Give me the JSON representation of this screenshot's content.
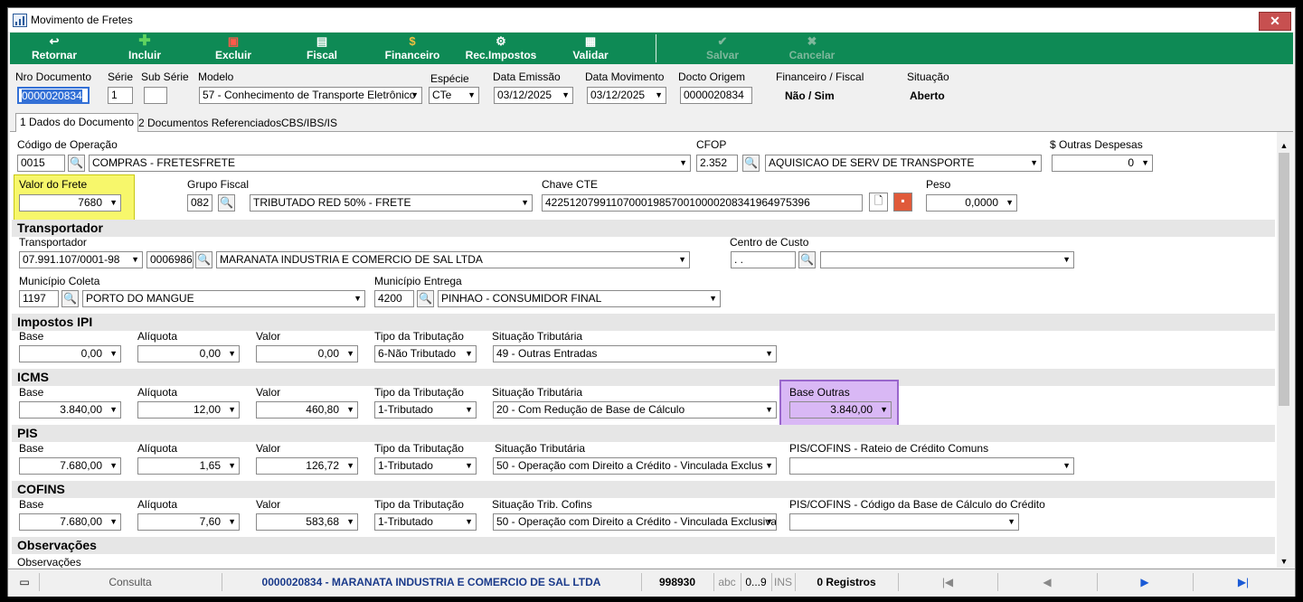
{
  "window": {
    "title": "Movimento de Fretes",
    "close_symbol": "✕"
  },
  "toolbar": {
    "retornar": "Retornar",
    "incluir": "Incluir",
    "excluir": "Excluir",
    "fiscal": "Fiscal",
    "financeiro": "Financeiro",
    "rec_impostos": "Rec.Impostos",
    "validar": "Validar",
    "salvar": "Salvar",
    "cancelar": "Cancelar"
  },
  "header": {
    "nro_documento_label": "Nro Documento",
    "nro_documento": "0000020834",
    "serie_label": "Série",
    "serie": "1",
    "sub_serie_label": "Sub Série",
    "sub_serie": "",
    "modelo_label": "Modelo",
    "modelo": "57 - Conhecimento de Transporte Eletrônico",
    "especie_label": "Espécie",
    "especie": "CTe",
    "data_emissao_label": "Data Emissão",
    "data_emissao": "03/12/2025",
    "data_movimento_label": "Data Movimento",
    "data_movimento": "03/12/2025",
    "docto_origem_label": "Docto Origem",
    "docto_origem": "0000020834",
    "financeiro_fiscal_label": "Financeiro / Fiscal",
    "financeiro_fiscal": "Não / Sim",
    "situacao_label": "Situação",
    "situacao": "Aberto"
  },
  "tabs": [
    "1 Dados do Documento",
    "2 Documentos Referenciados",
    "CBS/IBS/IS"
  ],
  "dados": {
    "codigo_operacao_label": "Código de Operação",
    "codigo_operacao": "0015",
    "operacao_desc": "COMPRAS - FRETESFRETE",
    "cfop_label": "CFOP",
    "cfop": "2.352",
    "cfop_desc": "AQUISICAO DE SERV DE TRANSPORTE",
    "outras_despesas_label": "$ Outras Despesas",
    "outras_despesas": "0",
    "valor_frete_label": "Valor do Frete",
    "valor_frete": "7680",
    "grupo_fiscal_label": "Grupo Fiscal",
    "grupo_fiscal": "082",
    "grupo_fiscal_desc": "TRIBUTADO RED 50%  - FRETE",
    "chave_cte_label": "Chave CTE",
    "chave_cte": "42251207991107000198570010000208341964975396",
    "peso_label": "Peso",
    "peso": "0,0000"
  },
  "transportador": {
    "section": "Transportador",
    "label": "Transportador",
    "cnpj": "07.991.107/0001-98",
    "codigo": "0006986",
    "nome": "MARANATA INDUSTRIA E COMERCIO DE SAL LTDA",
    "centro_custo_label": "Centro de Custo",
    "centro_custo": ".   .",
    "municipio_coleta_label": "Município Coleta",
    "municipio_coleta_cod": "1197",
    "municipio_coleta": "PORTO DO MANGUE",
    "municipio_entrega_label": "Município Entrega",
    "municipio_entrega_cod": "4200",
    "municipio_entrega": "PINHAO - CONSUMIDOR FINAL"
  },
  "ipi": {
    "section": "Impostos IPI",
    "base_label": "Base",
    "base": "0,00",
    "aliquota_label": "Alíquota",
    "aliquota": "0,00",
    "valor_label": "Valor",
    "valor": "0,00",
    "tipo_label": "Tipo da Tributação",
    "tipo": "6-Não Tributado",
    "situacao_label": "Situação Tributária",
    "situacao": "49 - Outras Entradas"
  },
  "icms": {
    "section": "ICMS",
    "base_label": "Base",
    "base": "3.840,00",
    "aliquota_label": "Alíquota",
    "aliquota": "12,00",
    "valor_label": "Valor",
    "valor": "460,80",
    "tipo_label": "Tipo da Tributação",
    "tipo": "1-Tributado",
    "situacao_label": "Situação Tributária",
    "situacao": "20 - Com Redução de Base de Cálculo",
    "base_outras_label": "Base Outras",
    "base_outras": "3.840,00"
  },
  "pis": {
    "section": "PIS",
    "base_label": "Base",
    "base": "7.680,00",
    "aliquota_label": "Alíquota",
    "aliquota": "1,65",
    "valor_label": "Valor",
    "valor": "126,72",
    "tipo_label": "Tipo da Tributação",
    "tipo": "1-Tributado",
    "situacao_label": "Situação Tributária",
    "situacao": "50 - Operação com Direito a Crédito - Vinculada Exclus",
    "rateio_label": "PIS/COFINS - Rateio de Crédito Comuns",
    "rateio": ""
  },
  "cofins": {
    "section": "COFINS",
    "base_label": "Base",
    "base": "7.680,00",
    "aliquota_label": "Alíquota",
    "aliquota": "7,60",
    "valor_label": "Valor",
    "valor": "583,68",
    "tipo_label": "Tipo da Tributação",
    "tipo": "1-Tributado",
    "situacao_label": "Situação Trib. Cofins",
    "situacao": "50 - Operação com Direito a Crédito - Vinculada Exclusivar",
    "codigo_base_label": "PIS/COFINS - Código da Base de Cálculo do Crédito",
    "codigo_base": ""
  },
  "observacoes": {
    "section": "Observações",
    "label": "Observações"
  },
  "statusbar": {
    "mode": "Consulta",
    "record": "0000020834 - MARANATA INDUSTRIA E COMERCIO DE SAL LTDA",
    "code": "998930",
    "abc": "abc",
    "num": "0...9",
    "ins": "INS",
    "registros": "0 Registros"
  },
  "colors": {
    "toolbar": "#0e8a55",
    "highlight_yellow": "#f7f76b",
    "highlight_purple": "#d9b8f5",
    "statusbar_text": "#1a3a8a"
  }
}
